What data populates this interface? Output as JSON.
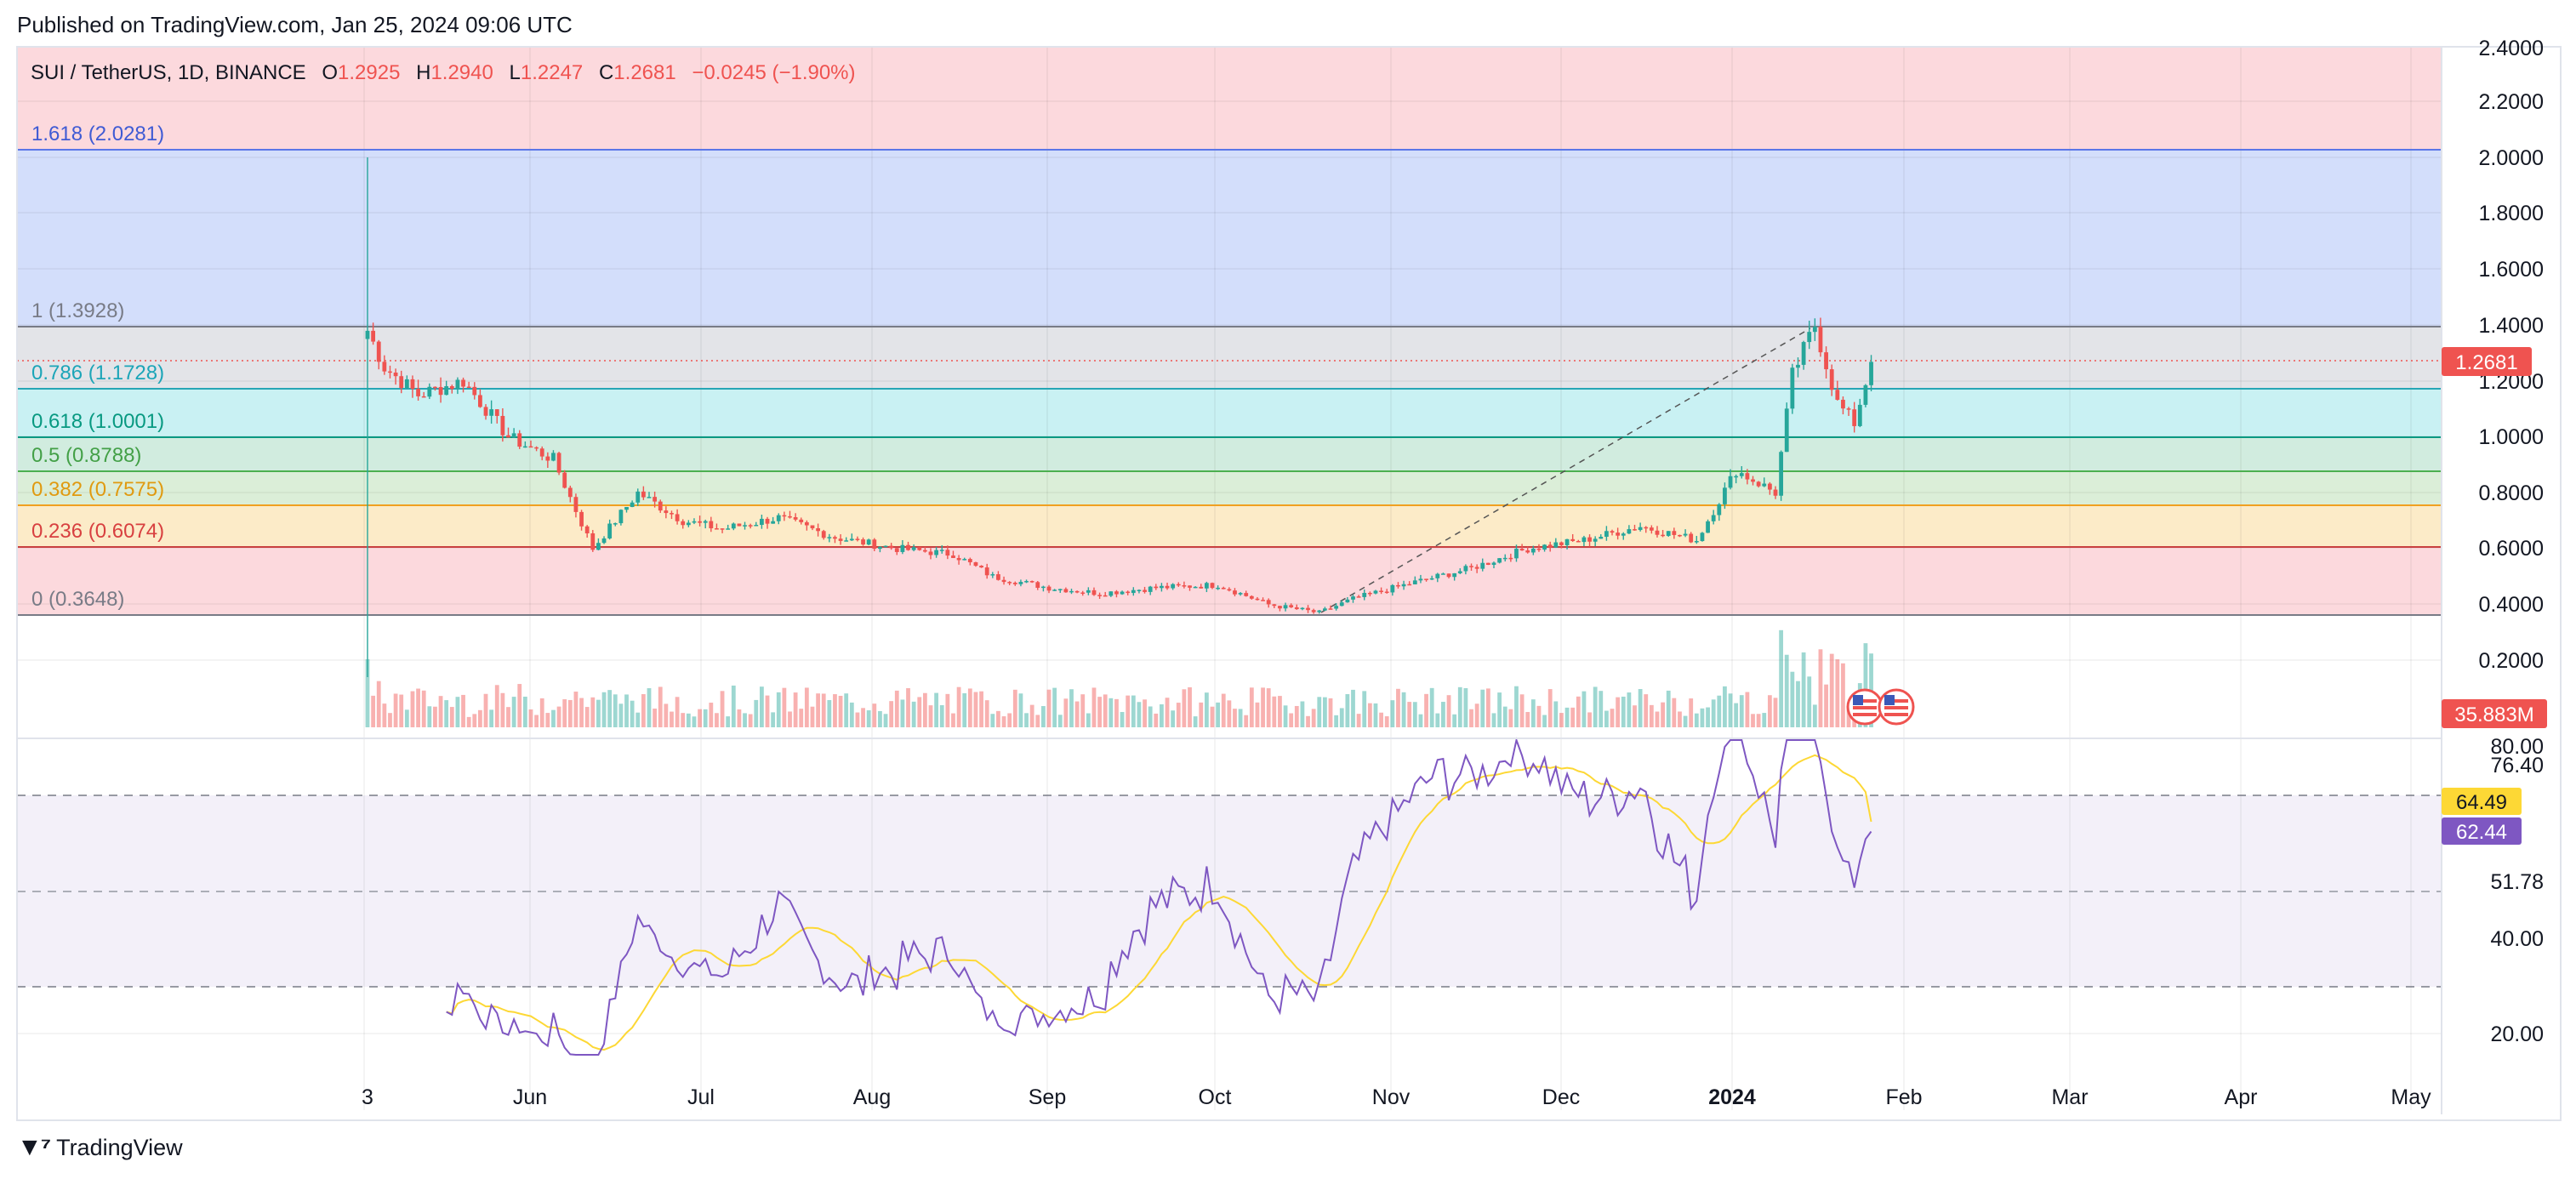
{
  "published": "Published on TradingView.com, Jan 25, 2024 09:06 UTC",
  "legend": {
    "symbol": "SUI / TetherUS, 1D, BINANCE",
    "o_label": "O",
    "o_value": "1.2925",
    "h_label": "H",
    "h_value": "1.2940",
    "l_label": "L",
    "l_value": "1.2247",
    "c_label": "C",
    "c_value": "1.2681",
    "change": "−0.0245 (−1.90%)"
  },
  "fib_labels": {
    "f1618": "1.618 (2.0281)",
    "f1": "1 (1.3928)",
    "f0786": "0.786 (1.1728)",
    "f0618": "0.618 (1.0001)",
    "f05": "0.5 (0.8788)",
    "f0382": "0.382 (0.7575)",
    "f0236": "0.236 (0.6074)",
    "f0": "0 (0.3648)"
  },
  "price_axis": [
    "2.4000",
    "2.2000",
    "2.0000",
    "1.8000",
    "1.6000",
    "1.4000",
    "1.2000",
    "1.0000",
    "0.8000",
    "0.6000",
    "0.4000",
    "0.2000"
  ],
  "price_badge": "1.2681",
  "volume_badge": "35.883M",
  "rsi_axis": {
    "t80": "80.00",
    "t7640": "76.40",
    "t5178": "51.78",
    "t40": "40.00",
    "t20": "20.00"
  },
  "rsi_badges": {
    "ma": "64.49",
    "rsi": "62.44"
  },
  "time_axis": [
    "3",
    "Jun",
    "Jul",
    "Aug",
    "Sep",
    "Oct",
    "Nov",
    "Dec",
    "2024",
    "Feb",
    "Mar",
    "Apr",
    "May"
  ],
  "brand": "TradingView",
  "colors": {
    "up": "#26a69a",
    "down": "#ef5350",
    "fib_blue": "#5b76e8",
    "fib_gray": "#787b86",
    "fib_teal": "#26c6da",
    "fib_green": "#089981",
    "fib_lgreen": "#4caf50",
    "fib_orange": "#f0a020",
    "fib_red": "#e04040",
    "rsi_line": "#7e57c2",
    "rsi_ma": "#fdd835"
  },
  "chart_data": {
    "type": "candlestick",
    "symbol": "SUI / TetherUS",
    "interval": "1D",
    "exchange": "BINANCE",
    "last_close": 1.2681,
    "fib_retracement": [
      {
        "level": 1.618,
        "price": 2.0281
      },
      {
        "level": 1,
        "price": 1.3928
      },
      {
        "level": 0.786,
        "price": 1.1728
      },
      {
        "level": 0.618,
        "price": 1.0001
      },
      {
        "level": 0.5,
        "price": 0.8788
      },
      {
        "level": 0.382,
        "price": 0.7575
      },
      {
        "level": 0.236,
        "price": 0.6074
      },
      {
        "level": 0,
        "price": 0.3648
      }
    ],
    "price_series": {
      "x": [
        "2023-05-03",
        "2023-05-06",
        "2023-05-12",
        "2023-05-20",
        "2023-05-28",
        "2023-06-05",
        "2023-06-12",
        "2023-06-20",
        "2023-06-28",
        "2023-07-05",
        "2023-07-15",
        "2023-07-25",
        "2023-08-05",
        "2023-08-15",
        "2023-08-22",
        "2023-09-01",
        "2023-09-10",
        "2023-09-20",
        "2023-10-01",
        "2023-10-10",
        "2023-10-19",
        "2023-10-25",
        "2023-11-05",
        "2023-11-15",
        "2023-11-25",
        "2023-12-05",
        "2023-12-15",
        "2023-12-25",
        "2024-01-01",
        "2024-01-08",
        "2024-01-11",
        "2024-01-15",
        "2024-01-19",
        "2024-01-22",
        "2024-01-25"
      ],
      "close": [
        1.38,
        1.25,
        1.15,
        1.2,
        1.0,
        0.92,
        0.6,
        0.8,
        0.7,
        0.67,
        0.71,
        0.64,
        0.6,
        0.58,
        0.5,
        0.46,
        0.44,
        0.46,
        0.47,
        0.4,
        0.37,
        0.42,
        0.48,
        0.53,
        0.6,
        0.63,
        0.68,
        0.63,
        0.88,
        0.8,
        1.22,
        1.4,
        1.12,
        1.05,
        1.2681
      ]
    },
    "rsi": {
      "levels": [
        80,
        76.4,
        51.78,
        40,
        20
      ],
      "last_rsi": 62.44,
      "last_ma": 64.49
    }
  }
}
